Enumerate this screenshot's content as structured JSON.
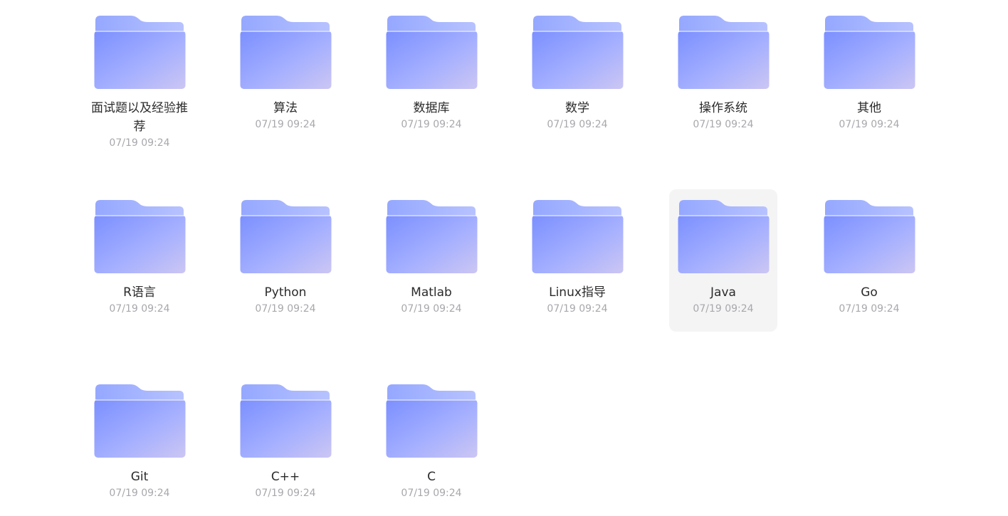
{
  "folders": [
    {
      "name": "面试题以及经验推荐",
      "date": "07/19 09:24"
    },
    {
      "name": "算法",
      "date": "07/19 09:24"
    },
    {
      "name": "数据库",
      "date": "07/19 09:24"
    },
    {
      "name": "数学",
      "date": "07/19 09:24"
    },
    {
      "name": "操作系统",
      "date": "07/19 09:24"
    },
    {
      "name": "其他",
      "date": "07/19 09:24"
    },
    {
      "name": "R语言",
      "date": "07/19 09:24"
    },
    {
      "name": "Python",
      "date": "07/19 09:24"
    },
    {
      "name": "Matlab",
      "date": "07/19 09:24"
    },
    {
      "name": "Linux指导",
      "date": "07/19 09:24"
    },
    {
      "name": "Java",
      "date": "07/19 09:24",
      "hovered": true
    },
    {
      "name": "Go",
      "date": "07/19 09:24"
    },
    {
      "name": "Git",
      "date": "07/19 09:24"
    },
    {
      "name": "C++",
      "date": "07/19 09:24"
    },
    {
      "name": "C",
      "date": "07/19 09:24"
    }
  ],
  "icons": {
    "folder": "folder-icon"
  },
  "colors": {
    "folder_back": "#9fb0ff",
    "folder_front_start": "#7b8fff",
    "folder_front_end": "#ccc6f3",
    "hover_bg": "#f4f4f5",
    "name_text": "#2b2b2b",
    "date_text": "#a8a8ad"
  }
}
